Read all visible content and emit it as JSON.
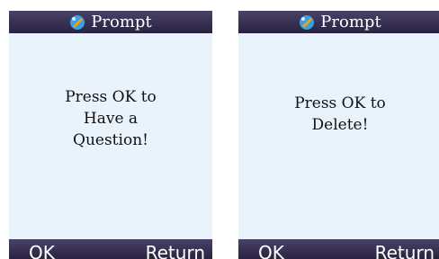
{
  "dialogs": [
    {
      "title": "Prompt",
      "icon": "prompt-icon",
      "message_lines": [
        "Press OK to",
        "Have a",
        "Question!"
      ],
      "ok_label": "OK",
      "return_label": "Return"
    },
    {
      "title": "Prompt",
      "icon": "prompt-icon",
      "message_lines": [
        "Press OK to",
        "Delete!"
      ],
      "ok_label": "OK",
      "return_label": "Return"
    }
  ],
  "colors": {
    "titlebar": "#2a2240",
    "screen_background": "#e9f3fb",
    "icon_blue": "#3aa0e0",
    "icon_orange": "#f0a020"
  }
}
